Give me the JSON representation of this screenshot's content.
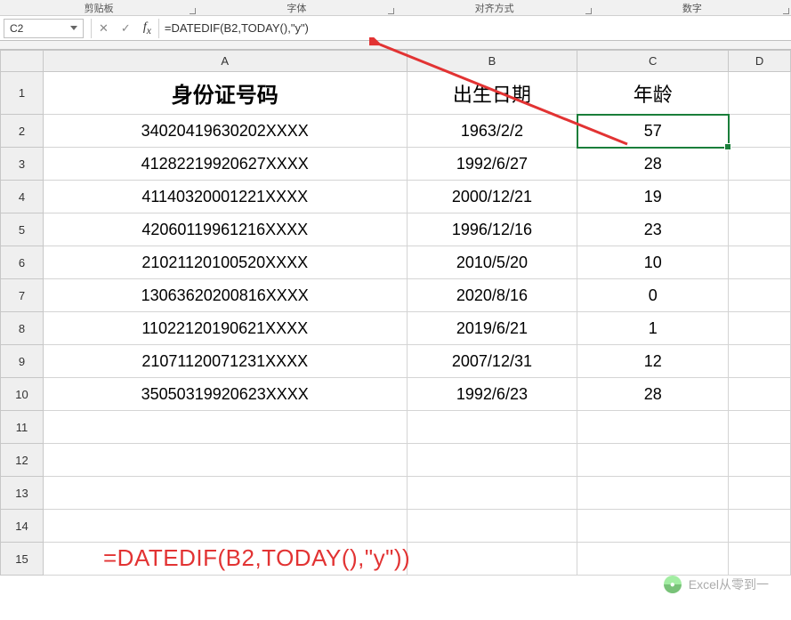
{
  "ribbon": {
    "groups": [
      "剪贴板",
      "字体",
      "对齐方式",
      "数字"
    ]
  },
  "namebox": "C2",
  "formula_bar": "=DATEDIF(B2,TODAY(),\"y\")",
  "columns": [
    "A",
    "B",
    "C",
    "D"
  ],
  "row_numbers": [
    "1",
    "2",
    "3",
    "4",
    "5",
    "6",
    "7",
    "8",
    "9",
    "10",
    "11",
    "12",
    "13",
    "14",
    "15"
  ],
  "headers": {
    "A": "身份证号码",
    "B": "出生日期",
    "C": "年龄"
  },
  "data_rows": [
    {
      "id": "34020419630202XXXX",
      "dob": "1963/2/2",
      "age": "57"
    },
    {
      "id": "41282219920627XXXX",
      "dob": "1992/6/27",
      "age": "28"
    },
    {
      "id": "41140320001221XXXX",
      "dob": "2000/12/21",
      "age": "19"
    },
    {
      "id": "42060119961216XXXX",
      "dob": "1996/12/16",
      "age": "23"
    },
    {
      "id": "21021120100520XXXX",
      "dob": "2010/5/20",
      "age": "10"
    },
    {
      "id": "13063620200816XXXX",
      "dob": "2020/8/16",
      "age": "0"
    },
    {
      "id": "11022120190621XXXX",
      "dob": "2019/6/21",
      "age": "1"
    },
    {
      "id": "21071120071231XXXX",
      "dob": "2007/12/31",
      "age": "12"
    },
    {
      "id": "35050319920623XXXX",
      "dob": "1992/6/23",
      "age": "28"
    }
  ],
  "annotation_formula": "=DATEDIF(B2,TODAY(),\"y\"))",
  "watermark": "Excel从零到一",
  "selected_cell": {
    "row": 2,
    "col": "C"
  }
}
